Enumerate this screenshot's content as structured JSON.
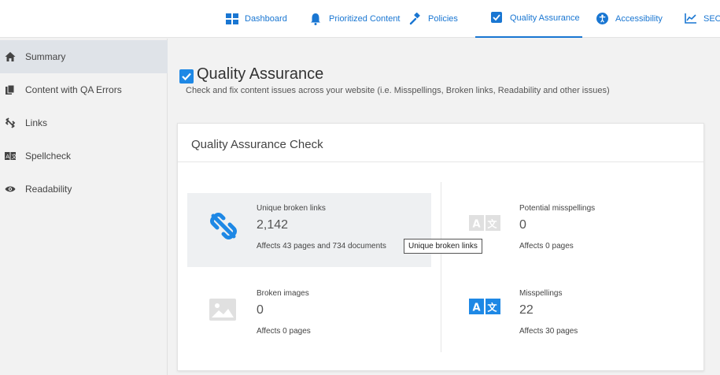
{
  "nav": {
    "items": [
      {
        "label": "Dashboard",
        "icon": "dashboard-icon"
      },
      {
        "label": "Prioritized Content",
        "icon": "bell-icon"
      },
      {
        "label": "Policies",
        "icon": "gavel-icon"
      },
      {
        "label": "Quality Assurance",
        "icon": "checkbox-icon",
        "active": true
      },
      {
        "label": "Accessibility",
        "icon": "accessibility-icon"
      },
      {
        "label": "SEO",
        "icon": "chart-line-icon"
      }
    ]
  },
  "sidebar": {
    "items": [
      {
        "label": "Summary",
        "icon": "home-icon",
        "active": true
      },
      {
        "label": "Content with QA Errors",
        "icon": "documents-icon"
      },
      {
        "label": "Links",
        "icon": "broken-link-icon"
      },
      {
        "label": "Spellcheck",
        "icon": "spellcheck-icon"
      },
      {
        "label": "Readability",
        "icon": "eye-icon"
      }
    ]
  },
  "page": {
    "title": "Quality Assurance",
    "subtitle": "Check and fix content issues across your website (i.e. Misspellings, Broken links, Readability and other issues)"
  },
  "card": {
    "title": "Quality Assurance Check",
    "tiles": [
      {
        "label": "Unique broken links",
        "value": "2,142",
        "affects": "Affects 43 pages and 734 documents",
        "icon": "broken-link-icon"
      },
      {
        "label": "Potential misspellings",
        "value": "0",
        "affects": "Affects 0 pages",
        "icon": "translate-icon"
      },
      {
        "label": "Broken images",
        "value": "0",
        "affects": "Affects 0 pages",
        "icon": "image-icon"
      },
      {
        "label": "Misspellings",
        "value": "22",
        "affects": "Affects 30 pages",
        "icon": "translate-icon"
      }
    ]
  },
  "tooltip": {
    "text": "Unique broken links"
  },
  "colors": {
    "accent": "#1e88e5",
    "muted_icon": "#e0e0e0"
  }
}
